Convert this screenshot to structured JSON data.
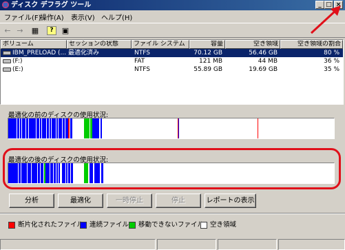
{
  "window": {
    "title": "ディスク デフラグ ツール"
  },
  "menu": [
    "ファイル(F)",
    "操作(A)",
    "表示(V)",
    "ヘルプ(H)"
  ],
  "toolbar": {
    "back": "←",
    "forward": "→",
    "view1": "▦",
    "help": "?",
    "view2": "▣"
  },
  "columns": [
    "ボリューム",
    "セッションの状態",
    "ファイル システム",
    "容量",
    "空き領域",
    "空き領域の割合"
  ],
  "volumes": [
    {
      "name": "IBM_PRELOAD (...",
      "status": "最適化済み",
      "fs": "NTFS",
      "capacity": "70.12 GB",
      "free": "56.46 GB",
      "pct": "80 %"
    },
    {
      "name": "(F:)",
      "status": "",
      "fs": "FAT",
      "capacity": "121 MB",
      "free": "44 MB",
      "pct": "36 %"
    },
    {
      "name": "(E:)",
      "status": "",
      "fs": "NTFS",
      "capacity": "55.89 GB",
      "free": "19.69 GB",
      "pct": "35 %"
    }
  ],
  "before_label": "最適化の前のディスクの使用状況:",
  "after_label": "最適化の後のディスクの使用状況:",
  "buttons": {
    "analyze": "分析",
    "defrag": "最適化",
    "pause": "一時停止",
    "stop": "停止",
    "report": "レポートの表示"
  },
  "legend": [
    {
      "label": "断片化されたファイル",
      "color": "#ff0000"
    },
    {
      "label": "連続ファイル",
      "color": "#0000ff"
    },
    {
      "label": "移動できないファイル",
      "color": "#00cc00"
    },
    {
      "label": "空き領域",
      "color": "#ffffff"
    }
  ],
  "colors": {
    "fragmented": "#ff0000",
    "contiguous": "#0000ff",
    "unmovable": "#00cc00",
    "free": "#ffffff",
    "highlight": "#e0101a"
  }
}
